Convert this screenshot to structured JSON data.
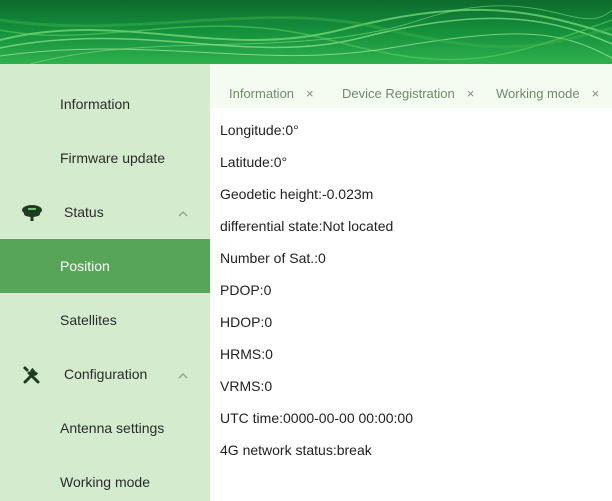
{
  "sidebar": {
    "items": [
      {
        "label": "Information"
      },
      {
        "label": "Firmware update"
      },
      {
        "label": "Status",
        "icon": "gnss-receiver-icon",
        "expanded": true
      },
      {
        "label": "Position",
        "active": true
      },
      {
        "label": "Satellites"
      },
      {
        "label": "Configuration",
        "icon": "tools-icon",
        "expanded": true
      },
      {
        "label": "Antenna settings"
      },
      {
        "label": "Working mode"
      }
    ]
  },
  "tabs": [
    {
      "label": "Information",
      "close": "×"
    },
    {
      "label": "Device Registration",
      "close": "×"
    },
    {
      "label": "Working mode",
      "close": "×"
    }
  ],
  "position_info": {
    "longitude": "Longitude:0°",
    "latitude": "Latitude:0°",
    "geodetic_height": "Geodetic height:-0.023m",
    "differential_state": "differential state:Not located",
    "num_sat": "Number of Sat.:0",
    "pdop": "PDOP:0",
    "hdop": "HDOP:0",
    "hrms": "HRMS:0",
    "vrms": "VRMS:0",
    "utc_time": "UTC time:0000-00-00 00:00:00",
    "network_status": "4G network status:break"
  },
  "colors": {
    "banner": "#138e3b",
    "sidebar_bg": "#d5ebce",
    "active_item": "#57a558",
    "tabbar_bg": "#f4fbf1"
  }
}
